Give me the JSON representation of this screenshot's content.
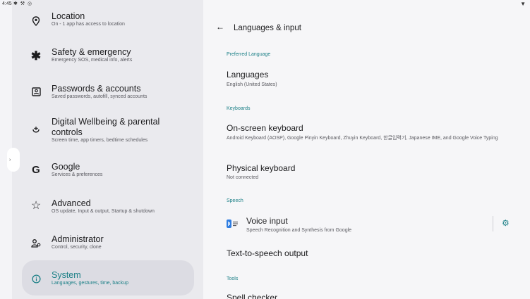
{
  "status": {
    "time": "4:45",
    "icons": "✱ ⚒ ◎"
  },
  "left": {
    "items": [
      {
        "title": "Location",
        "subtitle": "On - 1 app has access to location"
      },
      {
        "title": "Safety & emergency",
        "subtitle": "Emergency SOS, medical info, alerts"
      },
      {
        "title": "Passwords & accounts",
        "subtitle": "Saved passwords, autofill, synced accounts"
      },
      {
        "title": "Digital Wellbeing & parental",
        "title2": "controls",
        "subtitle": "Screen time, app timers, bedtime schedules"
      },
      {
        "title": "Google",
        "subtitle": "Services & preferences"
      },
      {
        "title": "Advanced",
        "subtitle": "OS update, Input & output, Startup & shutdown"
      },
      {
        "title": "Administrator",
        "subtitle": "Control, security, clone"
      },
      {
        "title": "System",
        "subtitle": "Languages, gestures, time, backup"
      }
    ]
  },
  "right": {
    "title": "Languages & input",
    "cat_preferred": "Preferred Language",
    "languages": {
      "title": "Languages",
      "subtitle": "English (United States)"
    },
    "cat_keyboards": "Keyboards",
    "onscreen": {
      "title": "On-screen keyboard",
      "subtitle": "Android Keyboard (AOSP), Google Pinyin Keyboard, Zhuyin Keyboard, 한글입력기, Japanese IME, and Google Voice Typing"
    },
    "physical": {
      "title": "Physical keyboard",
      "subtitle": "Not connected"
    },
    "cat_speech": "Speech",
    "voice": {
      "title": "Voice input",
      "subtitle": "Speech Recognition and Synthesis from Google"
    },
    "tts": {
      "title": "Text-to-speech output"
    },
    "cat_tools": "Tools",
    "spell": {
      "title": "Spell checker"
    }
  },
  "colors": {
    "accent": "#1a7f86",
    "selected_bg": "#dcdce3"
  },
  "icons": [
    "location-icon",
    "asterisk-icon",
    "account-box-icon",
    "wellbeing-icon",
    "google-icon",
    "star-outline-icon",
    "admin-icon",
    "info-icon",
    "back-arrow-icon",
    "voice-input-icon",
    "gear-icon",
    "wifi-icon"
  ]
}
